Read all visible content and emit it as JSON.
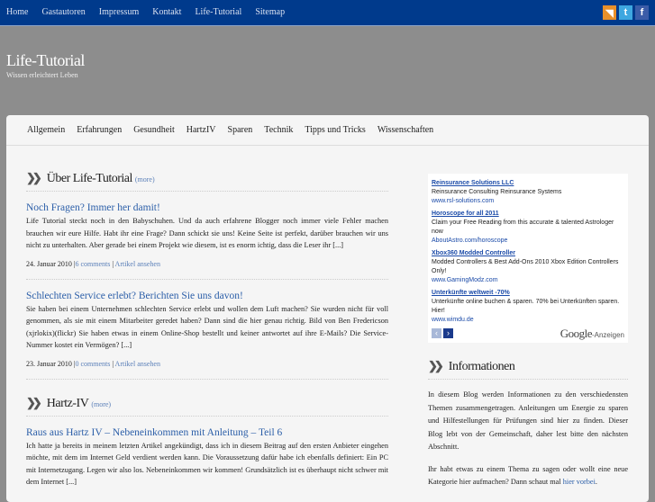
{
  "topnav": [
    "Home",
    "Gastautoren",
    "Impressum",
    "Kontakt",
    "Life-Tutorial",
    "Sitemap"
  ],
  "social": [
    {
      "icon": "rss-icon",
      "glyph": "◥",
      "color": "#e8902a"
    },
    {
      "icon": "twitter-icon",
      "glyph": "t",
      "color": "#3ea7e0"
    },
    {
      "icon": "facebook-icon",
      "glyph": "f",
      "color": "#3b5ca8"
    }
  ],
  "site": {
    "title": "Life-Tutorial",
    "tagline": "Wissen erleichtert Leben"
  },
  "categories": [
    "Allgemein",
    "Erfahrungen",
    "Gesundheit",
    "HartzIV",
    "Sparen",
    "Technik",
    "Tipps und Tricks",
    "Wissenschaften"
  ],
  "sections": [
    {
      "title": "Über Life-Tutorial",
      "more": "(more)",
      "posts": [
        {
          "title": "Noch Fragen? Immer her damit!",
          "excerpt": "Life Tutorial steckt noch in den Babyschuhen. Und da auch erfahrene Blogger noch immer viele Fehler machen brauchen wir eure Hilfe. Habt ihr eine Frage? Dann schickt sie uns! Keine Seite ist perfekt, darüber brauchen wir uns nicht zu unterhalten. Aber gerade bei einem Projekt wie diesem, ist es enorm ichtig, dass die Leser ihr [...]",
          "date": "24. Januar 2010 |",
          "comments": "6 comments",
          "sep": " | ",
          "view": "Artikel ansehen"
        },
        {
          "title": "Schlechten Service erlebt? Berichten Sie uns davon!",
          "excerpt": "Sie haben bei einem Unternehmen schlechten Service erlebt und wollen dem Luft machen? Sie wurden nicht für voll genommen, als sie mit einem Mitarbeiter geredet haben? Dann sind die hier genau richtig. Bild von Ben Fredericson (xjrlokix)(flickr) Sie haben etwas in einem Online-Shop bestellt und keiner antwortet auf ihre E-Mails? Die Service-Nummer kostet ein Vermögen? [...]",
          "date": "23. Januar 2010 |",
          "comments": "0 comments",
          "sep": " | ",
          "view": "Artikel ansehen"
        }
      ]
    },
    {
      "title": "Hartz-IV",
      "more": "(more)",
      "posts": [
        {
          "title": "Raus aus Hartz IV – Nebeneinkommen mit Anleitung – Teil 6",
          "excerpt": "Ich hatte ja bereits in meinem letzten Artikel angekündigt, dass ich in diesem Beitrag auf den ersten Anbieter eingehen möchte, mit dem im Internet Geld verdient werden kann. Die Voraussetzung dafür habe ich ebenfalls definiert: Ein PC mit Internetzugang. Legen wir also los. Nebeneinkommen wir kommen! Grundsätzlich ist es überhaupt nicht schwer mit dem Internet [...]"
        }
      ]
    }
  ],
  "ads": [
    {
      "title": "Reinsurance Solutions LLC",
      "desc": "Reinsurance Consulting Reinsurance Systems",
      "url": "www.rsl-solutions.com"
    },
    {
      "title": "Horoscope for all 2011",
      "desc": "Claim your Free Reading from this accurate & talented Astrologer now",
      "url": "AboutAstro.com/horoscope"
    },
    {
      "title": "Xbox360 Modded Controller",
      "desc": "Modded Controllers & Best Add-Ons 2010 Xbox Edition Controllers Only!",
      "url": "www.GamingModz.com"
    },
    {
      "title": "Unterkünfte weltweit -70%",
      "desc": "Unterkünfte online buchen & sparen. 70% bei Unterkünften sparen. Hier!",
      "url": "www.wimdu.de"
    }
  ],
  "adfooter": {
    "prev": "‹",
    "next": "›",
    "google": "Google",
    "label": "-Anzeigen"
  },
  "info": {
    "title": "Informationen",
    "p1": "In diesem Blog werden Informationen zu den verschiedensten Themen zusammengetragen. Anleitungen um Energie zu sparen und Hilfestellungen für Prüfungen sind hier zu finden. Dieser Blog lebt von der Gemeinschaft, daher lest bitte den nächsten Abschnitt.",
    "p2": "Ihr habt etwas zu einem Thema zu sagen oder wollt eine neue Kategorie hier aufmachen? Dann schaut mal ",
    "link": "hier vorbei",
    "end": "."
  }
}
